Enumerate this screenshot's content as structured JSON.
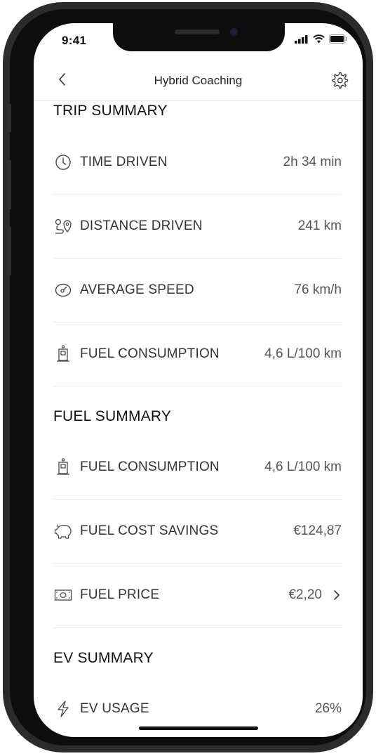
{
  "status_bar": {
    "time": "9:41"
  },
  "header": {
    "title": "Hybrid Coaching"
  },
  "trip_summary": {
    "title": "TRIP SUMMARY",
    "rows": [
      {
        "icon": "clock-icon",
        "label": "TIME DRIVEN",
        "value": "2h 34 min"
      },
      {
        "icon": "route-pin-icon",
        "label": "DISTANCE DRIVEN",
        "value": "241 km"
      },
      {
        "icon": "speedometer-icon",
        "label": "AVERAGE SPEED",
        "value": "76 km/h"
      },
      {
        "icon": "fuel-pump-icon",
        "label": "FUEL CONSUMPTION",
        "value": "4,6 L/100 km"
      }
    ]
  },
  "fuel_summary": {
    "title": "FUEL SUMMARY",
    "rows": [
      {
        "icon": "fuel-pump-icon",
        "label": "FUEL CONSUMPTION",
        "value": "4,6 L/100 km"
      },
      {
        "icon": "piggy-bank-icon",
        "label": "FUEL COST SAVINGS",
        "value": "€124,87"
      },
      {
        "icon": "banknote-icon",
        "label": "FUEL PRICE",
        "value": "€2,20"
      }
    ]
  },
  "ev_summary": {
    "title": "EV SUMMARY",
    "rows": [
      {
        "icon": "lightning-icon",
        "label": "EV USAGE",
        "value": "26%"
      }
    ]
  }
}
